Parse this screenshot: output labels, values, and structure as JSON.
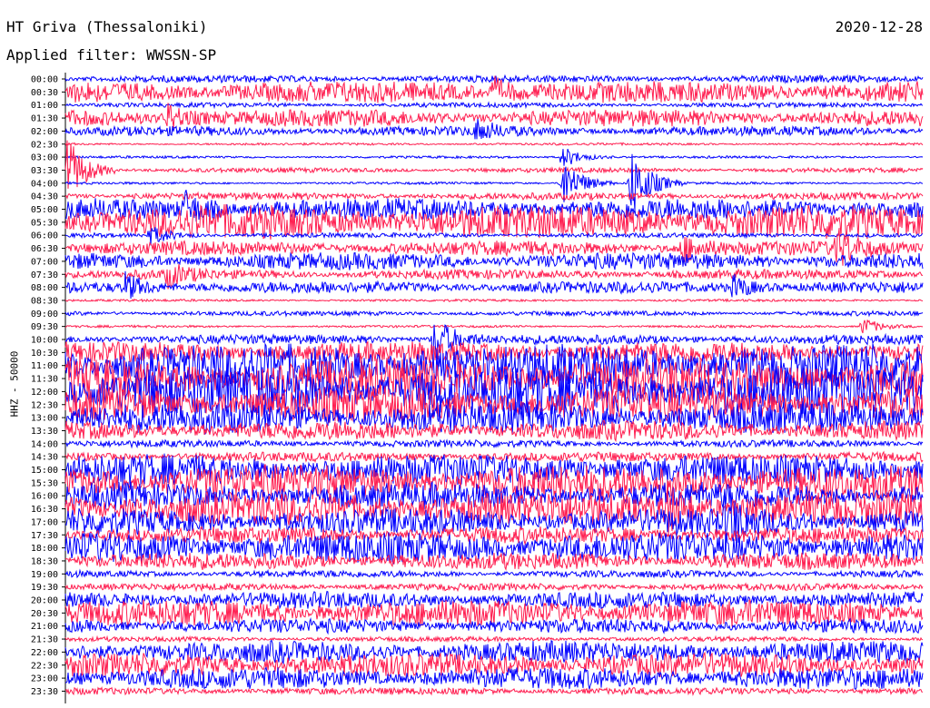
{
  "header": {
    "station": "HT Griva (Thessaloniki)",
    "date": "2020-12-28",
    "filter": "Applied filter: WWSSN-SP"
  },
  "chart_data": {
    "type": "line",
    "title": "HT Griva (Thessaloniki)",
    "ylabel": "HHZ - 50000",
    "row_labels": [
      "00:00",
      "00:30",
      "01:00",
      "01:30",
      "02:00",
      "02:30",
      "03:00",
      "03:30",
      "04:00",
      "04:30",
      "05:00",
      "05:30",
      "06:00",
      "06:30",
      "07:00",
      "07:30",
      "08:00",
      "08:30",
      "09:00",
      "09:30",
      "10:00",
      "10:30",
      "11:00",
      "11:30",
      "12:00",
      "12:30",
      "13:00",
      "13:30",
      "14:00",
      "14:30",
      "15:00",
      "15:30",
      "16:00",
      "16:30",
      "17:00",
      "17:30",
      "18:00",
      "18:30",
      "19:00",
      "19:30",
      "20:00",
      "20:30",
      "21:00",
      "21:30",
      "22:00",
      "22:30",
      "23:00",
      "23:30"
    ],
    "trace_colors": [
      "#0000ff",
      "#ff1e50"
    ],
    "grid": false,
    "noise_level": [
      3,
      9,
      2,
      7,
      4,
      1,
      1,
      2,
      1,
      3,
      9,
      14,
      2,
      6,
      7,
      4,
      5,
      1,
      2,
      1,
      4,
      9,
      18,
      17,
      21,
      15,
      13,
      8,
      3,
      4,
      13,
      15,
      11,
      14,
      11,
      7,
      13,
      7,
      3,
      3,
      7,
      11,
      6,
      2,
      9,
      10,
      9,
      3
    ],
    "events": [
      {
        "row": 1,
        "pos": 0.5,
        "amp": 12
      },
      {
        "row": 3,
        "pos": 0.12,
        "amp": 14
      },
      {
        "row": 4,
        "pos": 0.48,
        "amp": 10
      },
      {
        "row": 6,
        "pos": 0.58,
        "amp": 12
      },
      {
        "row": 7,
        "pos": 0.0,
        "amp": 40
      },
      {
        "row": 8,
        "pos": 0.58,
        "amp": 30
      },
      {
        "row": 8,
        "pos": 0.66,
        "amp": 40
      },
      {
        "row": 10,
        "pos": 0.14,
        "amp": 14
      },
      {
        "row": 12,
        "pos": 0.1,
        "amp": 10
      },
      {
        "row": 13,
        "pos": 0.72,
        "amp": 14
      },
      {
        "row": 13,
        "pos": 0.9,
        "amp": 18
      },
      {
        "row": 15,
        "pos": 0.12,
        "amp": 12
      },
      {
        "row": 16,
        "pos": 0.07,
        "amp": 14
      },
      {
        "row": 16,
        "pos": 0.78,
        "amp": 12
      },
      {
        "row": 19,
        "pos": 0.93,
        "amp": 10
      },
      {
        "row": 20,
        "pos": 0.43,
        "amp": 28
      },
      {
        "row": 33,
        "pos": 0.7,
        "amp": 24
      },
      {
        "row": 34,
        "pos": 0.77,
        "amp": 24
      }
    ],
    "xlim": [
      0,
      30
    ],
    "xunit": "minutes"
  }
}
